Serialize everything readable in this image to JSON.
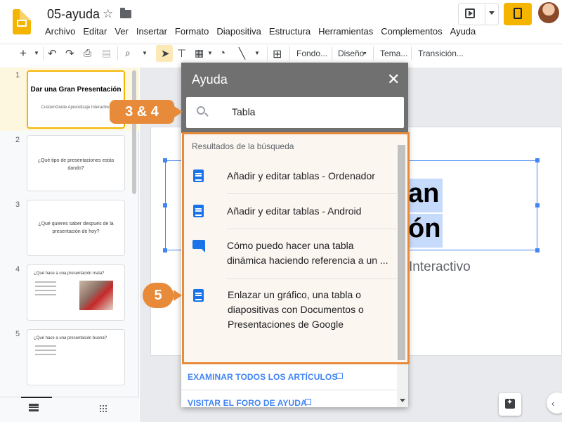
{
  "header": {
    "doc_title": "05-ayuda",
    "menu": [
      "Archivo",
      "Editar",
      "Ver",
      "Insertar",
      "Formato",
      "Diapositiva",
      "Estructura",
      "Herramientas",
      "Complementos",
      "Ayuda"
    ]
  },
  "toolbar": {
    "background_label": "Fondo...",
    "layout_label": "Diseño",
    "theme_label": "Tema...",
    "transition_label": "Transición..."
  },
  "filmstrip": {
    "slides": [
      {
        "number": "1",
        "title": "Dar una Gran Presentación",
        "subtitle": "CustomGuide Aprendizaje Interactivo"
      },
      {
        "number": "2",
        "text": "¿Qué tipo de presentaciones estás dando?"
      },
      {
        "number": "3",
        "text": "¿Qué quieres saber después de la presentación de hoy?"
      },
      {
        "number": "4",
        "text": "¿Qué hace a una presentación mala?"
      },
      {
        "number": "5",
        "text": "¿Qué hace a una presentación buena?"
      }
    ]
  },
  "slide": {
    "title_line_1": "an",
    "title_line_2": "ón",
    "subtitle": "Interactivo"
  },
  "help": {
    "title": "Ayuda",
    "search_value": "Tabla",
    "results_heading": "Resultados de la búsqueda",
    "results": [
      {
        "icon": "article-icon",
        "text": "Añadir y editar tablas - Ordenador"
      },
      {
        "icon": "article-icon",
        "text": "Añadir y editar tablas - Android"
      },
      {
        "icon": "forum-icon",
        "text": "Cómo puedo hacer una tabla dinámica haciendo referencia a un ..."
      },
      {
        "icon": "article-icon",
        "text": "Enlazar un gráfico, una tabla o diapositivas con Documentos o Presentaciones de Google"
      }
    ],
    "link_all_articles": "EXAMINAR TODOS LOS ARTÍCULOS",
    "link_forum": "VISITAR EL FORO DE AYUDA"
  },
  "callouts": {
    "step_34": "3 & 4",
    "step_5": "5"
  },
  "colors": {
    "accent_orange": "#e78a3a",
    "slides_yellow": "#f4b400",
    "link_blue": "#4285f4"
  }
}
